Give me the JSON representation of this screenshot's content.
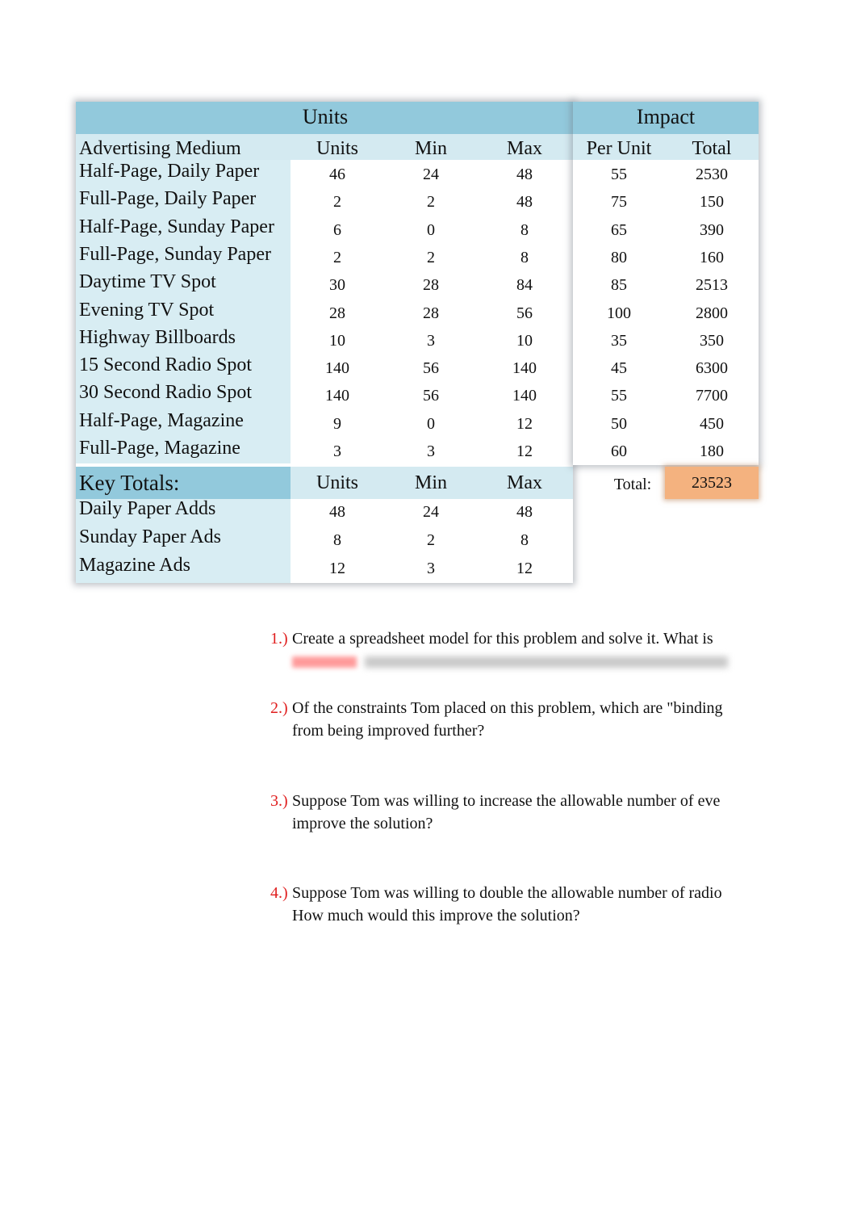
{
  "table": {
    "group_headers": {
      "units": "Units",
      "impact": "Impact"
    },
    "column_headers": {
      "medium": "Advertising Medium",
      "units": "Units",
      "min": "Min",
      "max": "Max",
      "per_unit": "Per Unit",
      "total": "Total"
    },
    "rows": [
      {
        "medium": "Half-Page, Daily Paper",
        "units": "46",
        "min": "24",
        "max": "48",
        "per_unit": "55",
        "total": "2530"
      },
      {
        "medium": "Full-Page, Daily Paper",
        "units": "2",
        "min": "2",
        "max": "48",
        "per_unit": "75",
        "total": "150"
      },
      {
        "medium": "Half-Page, Sunday Paper",
        "units": "6",
        "min": "0",
        "max": "8",
        "per_unit": "65",
        "total": "390"
      },
      {
        "medium": "Full-Page, Sunday Paper",
        "units": "2",
        "min": "2",
        "max": "8",
        "per_unit": "80",
        "total": "160"
      },
      {
        "medium": "Daytime TV Spot",
        "units": "30",
        "min": "28",
        "max": "84",
        "per_unit": "85",
        "total": "2513"
      },
      {
        "medium": "Evening TV Spot",
        "units": "28",
        "min": "28",
        "max": "56",
        "per_unit": "100",
        "total": "2800"
      },
      {
        "medium": "Highway Billboards",
        "units": "10",
        "min": "3",
        "max": "10",
        "per_unit": "35",
        "total": "350"
      },
      {
        "medium": "15 Second Radio Spot",
        "units": "140",
        "min": "56",
        "max": "140",
        "per_unit": "45",
        "total": "6300"
      },
      {
        "medium": "30 Second Radio Spot",
        "units": "140",
        "min": "56",
        "max": "140",
        "per_unit": "55",
        "total": "7700"
      },
      {
        "medium": "Half-Page, Magazine",
        "units": "9",
        "min": "0",
        "max": "12",
        "per_unit": "50",
        "total": "450"
      },
      {
        "medium": "Full-Page, Magazine",
        "units": "3",
        "min": "3",
        "max": "12",
        "per_unit": "60",
        "total": "180"
      }
    ],
    "total_label": "Total:",
    "total_value": "23523"
  },
  "key_totals": {
    "title": "Key Totals:",
    "column_headers": {
      "units": "Units",
      "min": "Min",
      "max": "Max"
    },
    "rows": [
      {
        "label": "Daily Paper Adds",
        "units": "48",
        "min": "24",
        "max": "48"
      },
      {
        "label": "Sunday Paper Ads",
        "units": "8",
        "min": "2",
        "max": "8"
      },
      {
        "label": "Magazine Ads",
        "units": "12",
        "min": "3",
        "max": "12"
      }
    ]
  },
  "questions": [
    {
      "number": "1.)",
      "lines": [
        "Create a spreadsheet model for this problem and solve it. What is"
      ]
    },
    {
      "number": "2.)",
      "lines": [
        "Of the constraints Tom placed on this problem, which are \"binding",
        "from being improved further?"
      ]
    },
    {
      "number": "3.)",
      "lines": [
        "Suppose Tom was willing to increase the allowable number of eve",
        "improve the solution?"
      ]
    },
    {
      "number": "4.)",
      "lines": [
        "Suppose Tom was willing to double the allowable number of radio",
        "How much would this improve the solution?"
      ]
    }
  ],
  "colors": {
    "header_blue": "#92c9dc",
    "light_blue": "#d8edf3",
    "total_orange": "#f4b27f",
    "question_number_red": "#e01f1f"
  }
}
